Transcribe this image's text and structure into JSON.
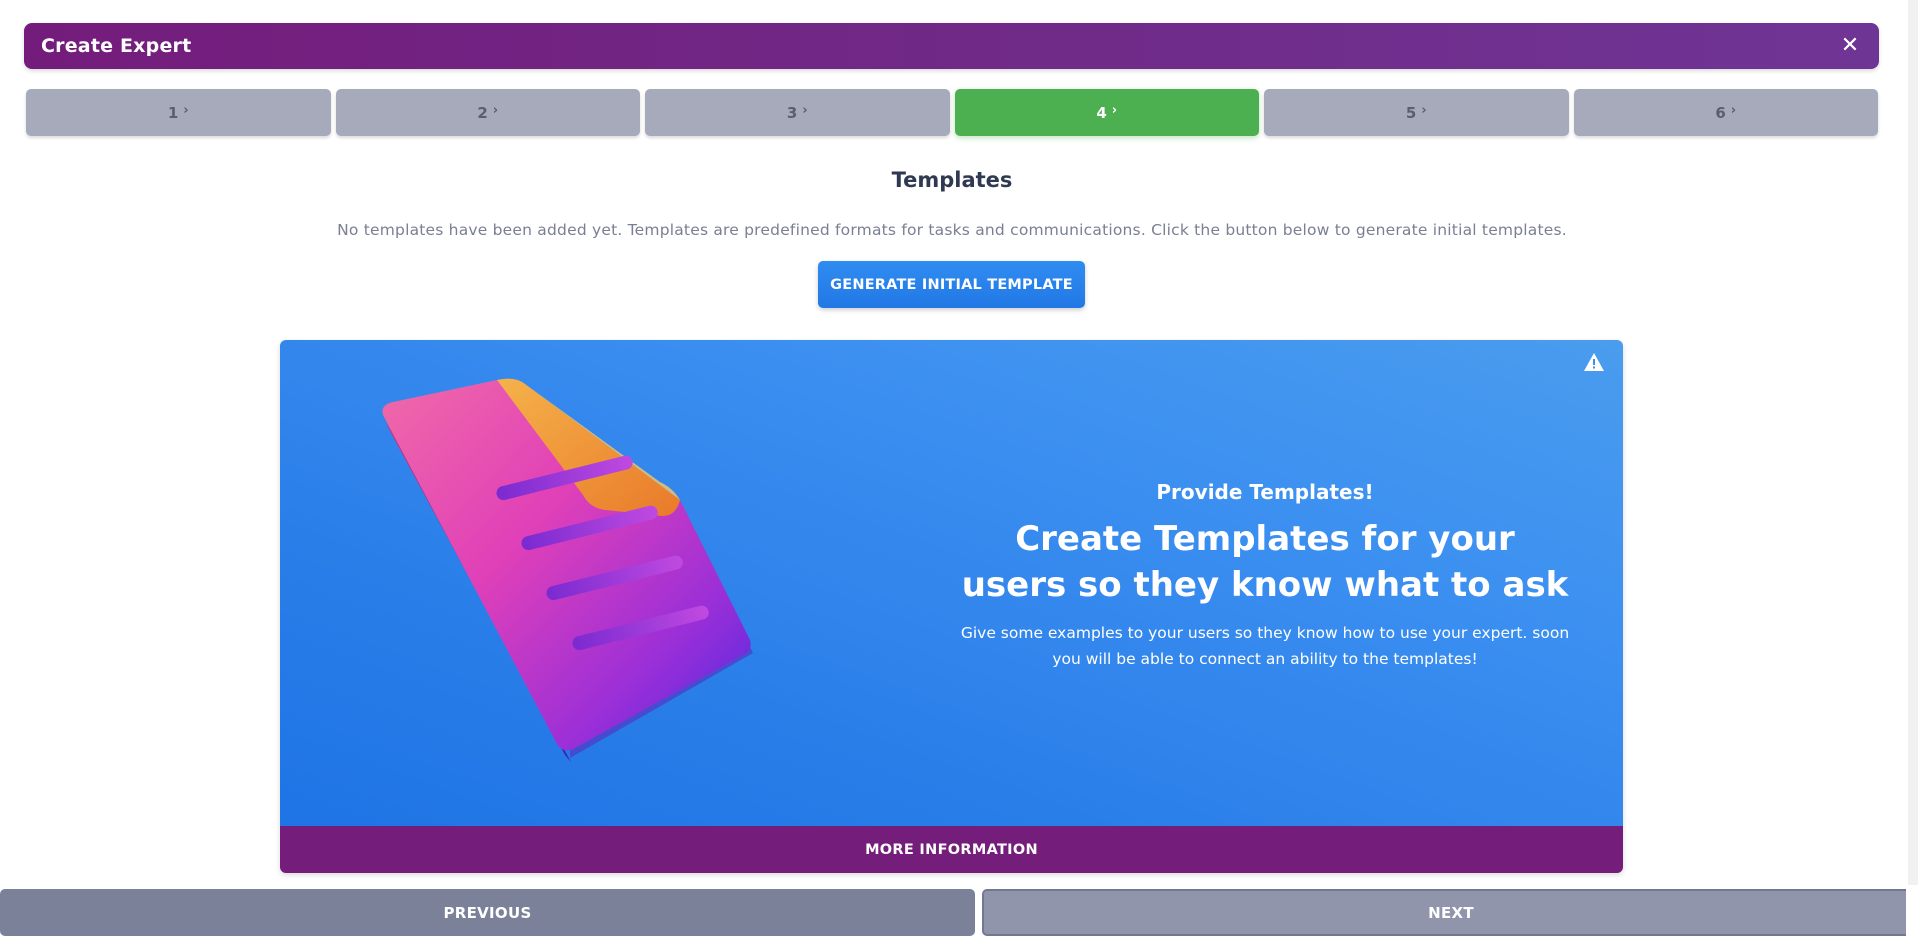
{
  "header": {
    "title": "Create Expert",
    "close_label": "✕"
  },
  "steps": [
    {
      "label": "1",
      "active": false
    },
    {
      "label": "2",
      "active": false
    },
    {
      "label": "3",
      "active": false
    },
    {
      "label": "4",
      "active": true
    },
    {
      "label": "5",
      "active": false
    },
    {
      "label": "6",
      "active": false
    }
  ],
  "section": {
    "title": "Templates",
    "description": "No templates have been added yet. Templates are predefined formats for tasks and communications. Click the button below to generate initial templates.",
    "generate_label": "GENERATE INITIAL TEMPLATE"
  },
  "banner": {
    "eyebrow": "Provide Templates!",
    "heading": "Create Templates for your users so they know what to ask",
    "body": "Give some examples to your users so they know how to use your expert. soon you will be able to connect an ability to the templates!",
    "more_info_label": "MORE INFORMATION",
    "warning_icon": "warning-triangle-icon",
    "illustration_icon": "document-icon"
  },
  "footer": {
    "previous_label": "PREVIOUS",
    "next_label": "NEXT"
  },
  "colors": {
    "header": "#741c7c",
    "step_inactive": "#a6aaba",
    "step_active": "#4caf50",
    "primary_button": "#2278e6",
    "banner": "#3a8ef0",
    "more_info": "#741d7b",
    "previous": "#7b8199",
    "next": "#9095ac"
  }
}
